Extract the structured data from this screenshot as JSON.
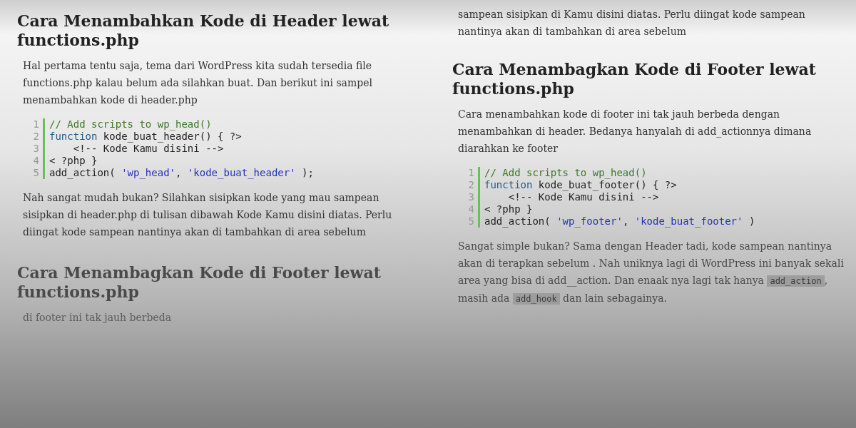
{
  "left_column": {
    "sections": [
      {
        "kind": "heading",
        "text": "Cara Menambahkan Kode di Header lewat functions.php"
      },
      {
        "kind": "paragraph",
        "segments": [
          {
            "kind": "text",
            "text": "Hal pertama tentu saja, tema dari WordPress kita sudah tersedia file functions.php kalau belum ada silahkan buat. Dan berikut ini sampel menambahkan kode di header.php"
          }
        ]
      },
      {
        "kind": "code",
        "lines": [
          {
            "number": "1",
            "tokens": [
              {
                "kind": "comment",
                "text": "// Add scripts to wp_head()"
              }
            ]
          },
          {
            "number": "2",
            "tokens": [
              {
                "kind": "keyword",
                "text": "function"
              },
              {
                "kind": "plain",
                "text": " kode_buat_header() { ?>"
              }
            ]
          },
          {
            "number": "3",
            "tokens": [
              {
                "kind": "plain",
                "text": "    <!-- Kode Kamu disini -->"
              }
            ]
          },
          {
            "number": "4",
            "tokens": [
              {
                "kind": "plain",
                "text": "< ?php }"
              }
            ]
          },
          {
            "number": "5",
            "tokens": [
              {
                "kind": "plain",
                "text": "add_action( "
              },
              {
                "kind": "string",
                "text": "'wp_head'"
              },
              {
                "kind": "plain",
                "text": ", "
              },
              {
                "kind": "string",
                "text": "'kode_buat_header'"
              },
              {
                "kind": "plain",
                "text": " );"
              }
            ]
          }
        ]
      },
      {
        "kind": "paragraph",
        "segments": [
          {
            "kind": "text",
            "text": "Nah sangat mudah bukan? Silahkan sisipkan kode yang mau sampean sisipkan di header.php di tulisan dibawah Kode Kamu disini diatas. Perlu diingat kode sampean nantinya akan di tambahkan di area sebelum"
          }
        ]
      },
      {
        "kind": "heading",
        "text": "Cara Menambagkan Kode di Footer lewat functions.php"
      },
      {
        "kind": "paragraph",
        "segments": [
          {
            "kind": "text",
            "text": "di footer ini tak jauh berbeda"
          }
        ]
      }
    ]
  },
  "right_column": {
    "sections": [
      {
        "kind": "paragraph",
        "segments": [
          {
            "kind": "text",
            "text": "sampean sisipkan di Kamu disini diatas. Perlu diingat kode sampean nantinya akan di tambahkan di area sebelum"
          }
        ]
      },
      {
        "kind": "heading",
        "text": "Cara Menambagkan Kode di Footer lewat functions.php"
      },
      {
        "kind": "paragraph",
        "segments": [
          {
            "kind": "text",
            "text": "Cara menambahkan kode di footer ini tak jauh berbeda dengan menambahkan di header. Bedanya hanyalah di add_actionnya dimana diarahkan ke footer"
          }
        ]
      },
      {
        "kind": "code",
        "lines": [
          {
            "number": "1",
            "tokens": [
              {
                "kind": "comment",
                "text": "// Add scripts to wp_head()"
              }
            ]
          },
          {
            "number": "2",
            "tokens": [
              {
                "kind": "keyword",
                "text": "function"
              },
              {
                "kind": "plain",
                "text": " kode_buat_footer() { ?>"
              }
            ]
          },
          {
            "number": "3",
            "tokens": [
              {
                "kind": "plain",
                "text": "    <!-- Kode Kamu disini -->"
              }
            ]
          },
          {
            "number": "4",
            "tokens": [
              {
                "kind": "plain",
                "text": "< ?php }"
              }
            ]
          },
          {
            "number": "5",
            "tokens": [
              {
                "kind": "plain",
                "text": "add_action( "
              },
              {
                "kind": "string",
                "text": "'wp_footer'"
              },
              {
                "kind": "plain",
                "text": ", "
              },
              {
                "kind": "string",
                "text": "'kode_buat_footer'"
              },
              {
                "kind": "plain",
                "text": " )"
              }
            ]
          }
        ]
      },
      {
        "kind": "paragraph",
        "segments": [
          {
            "kind": "text",
            "text": "Sangat simple bukan? Sama dengan Header tadi, kode sampean nantinya akan di terapkan sebelum . Nah uniknya lagi di WordPress ini banyak sekali area yang bisa di add__action. Dan enaak nya lagi tak hanya "
          },
          {
            "kind": "code",
            "text": "add_action"
          },
          {
            "kind": "text",
            "text": ", masih ada "
          },
          {
            "kind": "code",
            "text": "add_hook"
          },
          {
            "kind": "text",
            "text": " dan lain sebagainya."
          }
        ]
      }
    ]
  }
}
